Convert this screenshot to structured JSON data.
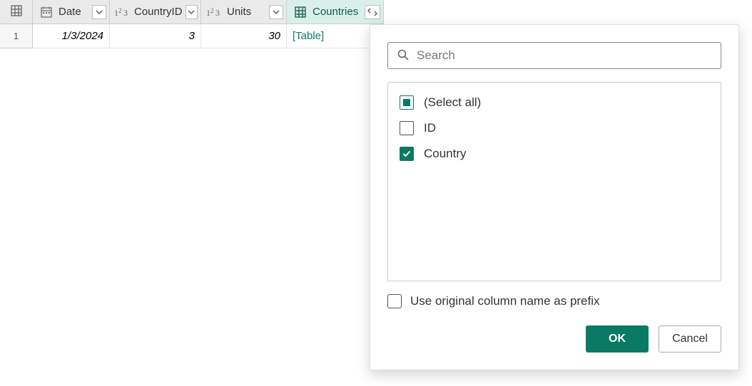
{
  "columns": [
    {
      "name": "Date",
      "type": "date"
    },
    {
      "name": "CountryID",
      "type": "number"
    },
    {
      "name": "Units",
      "type": "number"
    },
    {
      "name": "Countries",
      "type": "table"
    }
  ],
  "rows": [
    {
      "index": "1",
      "Date": "1/3/2024",
      "CountryID": "3",
      "Units": "30",
      "Countries": "[Table]"
    }
  ],
  "expand_panel": {
    "search_placeholder": "Search",
    "options": {
      "select_all": "(Select all)",
      "id": "ID",
      "country": "Country"
    },
    "use_prefix_label": "Use original column name as prefix",
    "ok_label": "OK",
    "cancel_label": "Cancel"
  }
}
